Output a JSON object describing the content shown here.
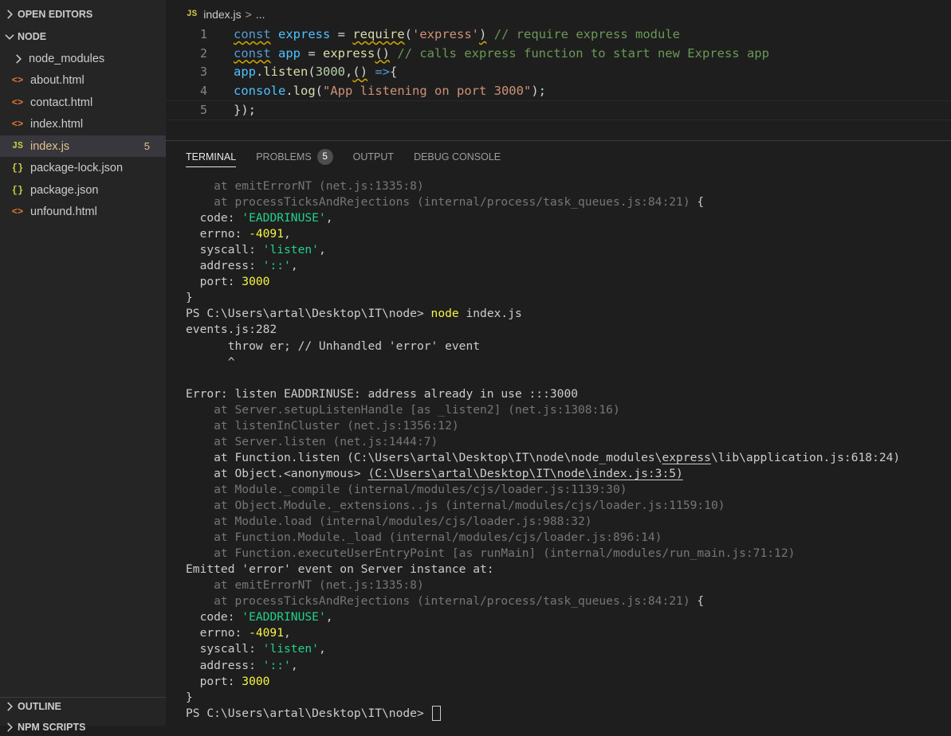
{
  "sidebar": {
    "open_editors_label": "OPEN EDITORS",
    "folder_label": "NODE",
    "items": [
      {
        "label": "node_modules",
        "type": "folder"
      },
      {
        "label": "about.html",
        "type": "html",
        "icon": "html-file-icon"
      },
      {
        "label": "contact.html",
        "type": "html",
        "icon": "html-file-icon"
      },
      {
        "label": "index.html",
        "type": "html",
        "icon": "html-file-icon"
      },
      {
        "label": "index.js",
        "type": "js",
        "icon": "js-file-icon",
        "count": "5",
        "active": true
      },
      {
        "label": "package-lock.json",
        "type": "json",
        "icon": "json-file-icon"
      },
      {
        "label": "package.json",
        "type": "json",
        "icon": "json-file-icon"
      },
      {
        "label": "unfound.html",
        "type": "html",
        "icon": "html-file-icon"
      }
    ],
    "outline_label": "OUTLINE",
    "timeline_label": "NPM SCRIPTS",
    "icon_glyphs": {
      "html": "<>",
      "js": "JS",
      "json": "{}"
    }
  },
  "breadcrumb": {
    "file_icon": "JS",
    "file": "index.js",
    "separator": ">",
    "rest": "..."
  },
  "editor": {
    "line_numbers": [
      "1",
      "2",
      "3",
      "4",
      "5"
    ],
    "lines": [
      [
        "const",
        " ",
        "express",
        " = ",
        "require",
        "(",
        "'express'",
        ")",
        " // require express module"
      ],
      [
        "const",
        " ",
        "app",
        " = ",
        "express",
        "()",
        " // calls express function to start new Express app"
      ],
      [
        "app",
        ".",
        "listen",
        "(",
        "3000",
        ",",
        "()",
        " =>",
        "{"
      ],
      [
        "console",
        ".",
        "log",
        "(",
        "\"App listening on port 3000\"",
        ");"
      ],
      [
        "});"
      ]
    ]
  },
  "panel": {
    "tabs": {
      "terminal": "TERMINAL",
      "problems": "PROBLEMS",
      "problems_count": "5",
      "output": "OUTPUT",
      "debug_console": "DEBUG CONSOLE"
    }
  },
  "terminal": {
    "lines": [
      [
        {
          "t": "    at emitErrorNT (net.js:1335:8)",
          "c": "dim"
        }
      ],
      [
        {
          "t": "    at processTicksAndRejections (internal/process/task_queues.js:84:21)",
          "c": "dim"
        },
        {
          "t": " {",
          "c": ""
        }
      ],
      [
        {
          "t": "  code: ",
          "c": ""
        },
        {
          "t": "'EADDRINUSE'",
          "c": "tstr"
        },
        {
          "t": ",",
          "c": ""
        }
      ],
      [
        {
          "t": "  errno: ",
          "c": ""
        },
        {
          "t": "-4091",
          "c": "tnum"
        },
        {
          "t": ",",
          "c": ""
        }
      ],
      [
        {
          "t": "  syscall: ",
          "c": ""
        },
        {
          "t": "'listen'",
          "c": "tstr"
        },
        {
          "t": ",",
          "c": ""
        }
      ],
      [
        {
          "t": "  address: ",
          "c": ""
        },
        {
          "t": "'::'",
          "c": "tstr"
        },
        {
          "t": ",",
          "c": ""
        }
      ],
      [
        {
          "t": "  port: ",
          "c": ""
        },
        {
          "t": "3000",
          "c": "tnum"
        }
      ],
      [
        {
          "t": "}",
          "c": ""
        }
      ],
      [
        {
          "t": "PS C:\\Users\\artal\\Desktop\\IT\\node> ",
          "c": ""
        },
        {
          "t": "node",
          "c": "tcmd"
        },
        {
          "t": " index.js",
          "c": ""
        }
      ],
      [
        {
          "t": "events.js:282",
          "c": ""
        }
      ],
      [
        {
          "t": "      throw er; // Unhandled 'error' event",
          "c": ""
        }
      ],
      [
        {
          "t": "      ^",
          "c": ""
        }
      ],
      [
        {
          "t": "",
          "c": ""
        }
      ],
      [
        {
          "t": "Error: listen EADDRINUSE: address already in use :::3000",
          "c": ""
        }
      ],
      [
        {
          "t": "    at Server.setupListenHandle [as _listen2] (net.js:1308:16)",
          "c": "dim"
        }
      ],
      [
        {
          "t": "    at listenInCluster (net.js:1356:12)",
          "c": "dim"
        }
      ],
      [
        {
          "t": "    at Server.listen (net.js:1444:7)",
          "c": "dim"
        }
      ],
      [
        {
          "t": "    at Function.listen (C:\\Users\\artal\\Desktop\\IT\\node\\node_modules\\",
          "c": ""
        },
        {
          "t": "express",
          "c": "uline"
        },
        {
          "t": "\\lib\\application.js:618:24)",
          "c": ""
        }
      ],
      [
        {
          "t": "    at Object.<anonymous> ",
          "c": ""
        },
        {
          "t": "(C:\\Users\\artal\\Desktop\\IT\\node\\index.js:3:5)",
          "c": "uline"
        }
      ],
      [
        {
          "t": "    at Module._compile (internal/modules/cjs/loader.js:1139:30)",
          "c": "dim"
        }
      ],
      [
        {
          "t": "    at Object.Module._extensions..js (internal/modules/cjs/loader.js:1159:10)",
          "c": "dim"
        }
      ],
      [
        {
          "t": "    at Module.load (internal/modules/cjs/loader.js:988:32)",
          "c": "dim"
        }
      ],
      [
        {
          "t": "    at Function.Module._load (internal/modules/cjs/loader.js:896:14)",
          "c": "dim"
        }
      ],
      [
        {
          "t": "    at Function.executeUserEntryPoint [as runMain] (internal/modules/run_main.js:71:12)",
          "c": "dim"
        }
      ],
      [
        {
          "t": "Emitted 'error' event on Server instance at:",
          "c": ""
        }
      ],
      [
        {
          "t": "    at emitErrorNT (net.js:1335:8)",
          "c": "dim"
        }
      ],
      [
        {
          "t": "    at processTicksAndRejections (internal/process/task_queues.js:84:21)",
          "c": "dim"
        },
        {
          "t": " {",
          "c": ""
        }
      ],
      [
        {
          "t": "  code: ",
          "c": ""
        },
        {
          "t": "'EADDRINUSE'",
          "c": "tstr"
        },
        {
          "t": ",",
          "c": ""
        }
      ],
      [
        {
          "t": "  errno: ",
          "c": ""
        },
        {
          "t": "-4091",
          "c": "tnum"
        },
        {
          "t": ",",
          "c": ""
        }
      ],
      [
        {
          "t": "  syscall: ",
          "c": ""
        },
        {
          "t": "'listen'",
          "c": "tstr"
        },
        {
          "t": ",",
          "c": ""
        }
      ],
      [
        {
          "t": "  address: ",
          "c": ""
        },
        {
          "t": "'::'",
          "c": "tstr"
        },
        {
          "t": ",",
          "c": ""
        }
      ],
      [
        {
          "t": "  port: ",
          "c": ""
        },
        {
          "t": "3000",
          "c": "tnum"
        }
      ],
      [
        {
          "t": "}",
          "c": ""
        }
      ]
    ],
    "prompt": "PS C:\\Users\\artal\\Desktop\\IT\\node> "
  },
  "colors": {
    "background": "#1e1e1e",
    "sidebar": "#252526",
    "active_item": "#37373d",
    "terminal_string": "#23d18b",
    "terminal_number": "#f5f543"
  }
}
